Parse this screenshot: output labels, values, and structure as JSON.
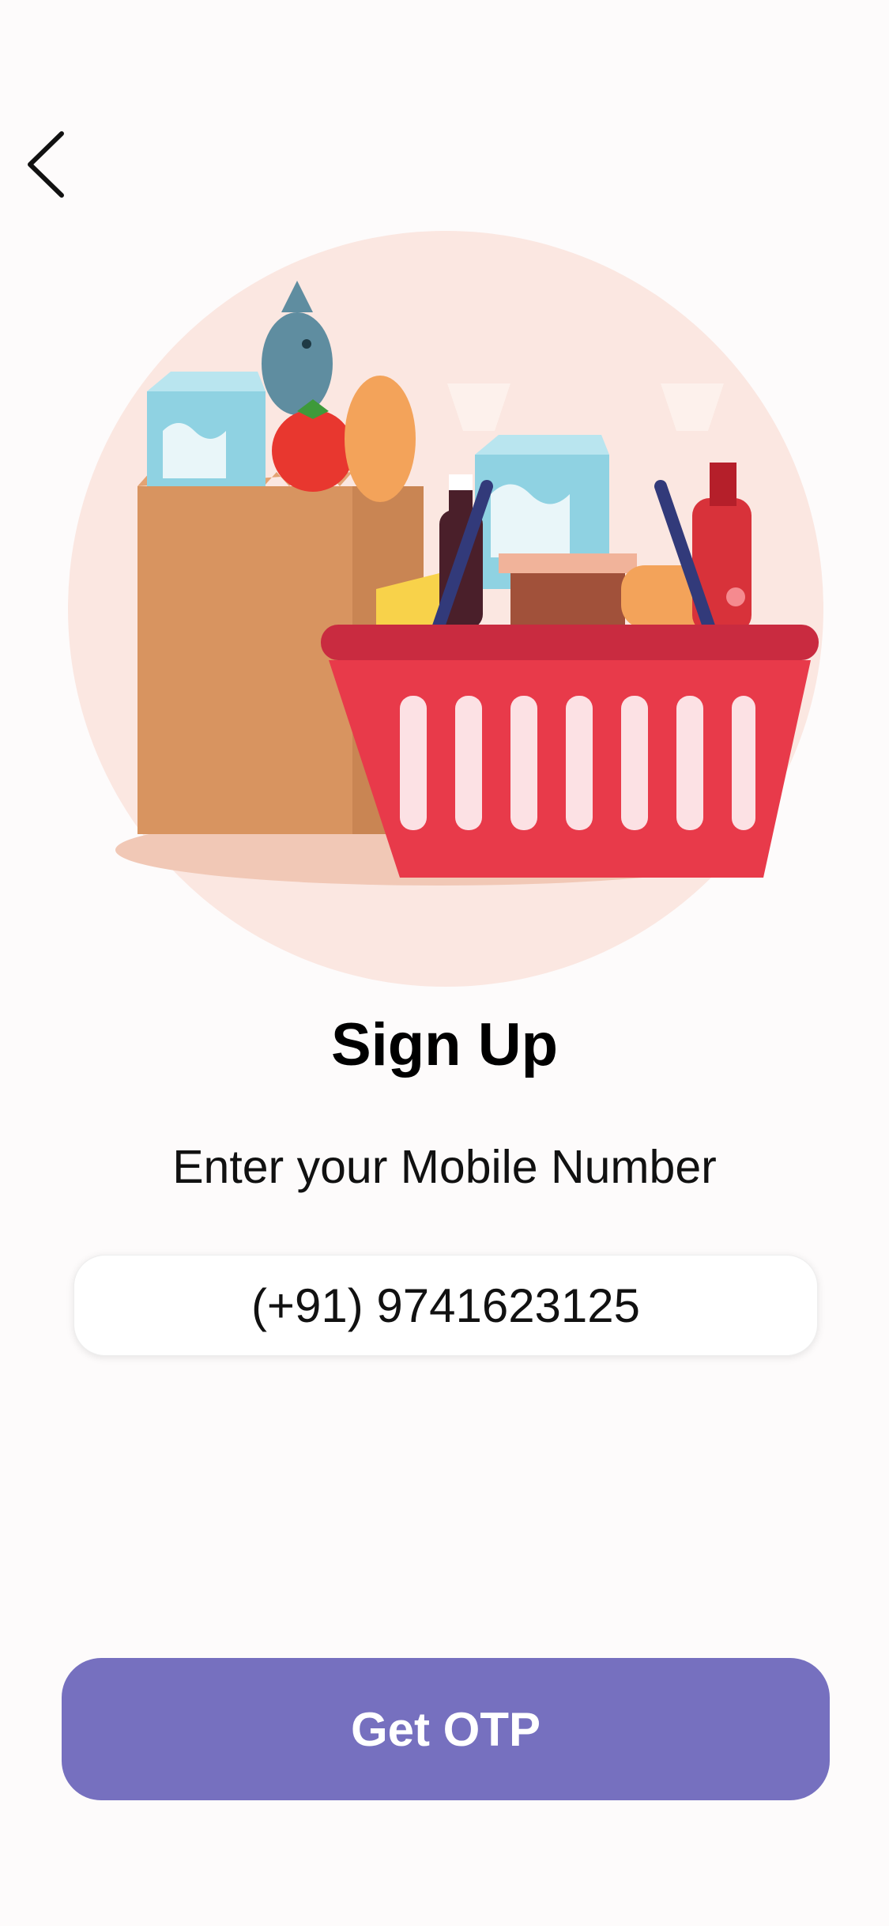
{
  "header": {
    "back_icon": "chevron-left-icon"
  },
  "hero": {
    "illustration": "grocery-basket-illustration",
    "bg_color": "#fbe7e1"
  },
  "signup": {
    "title": "Sign Up",
    "subtitle": "Enter your Mobile Number",
    "phone_value": "(+91) 9741623125"
  },
  "actions": {
    "get_otp_label": "Get OTP",
    "button_color": "#7670bf"
  }
}
